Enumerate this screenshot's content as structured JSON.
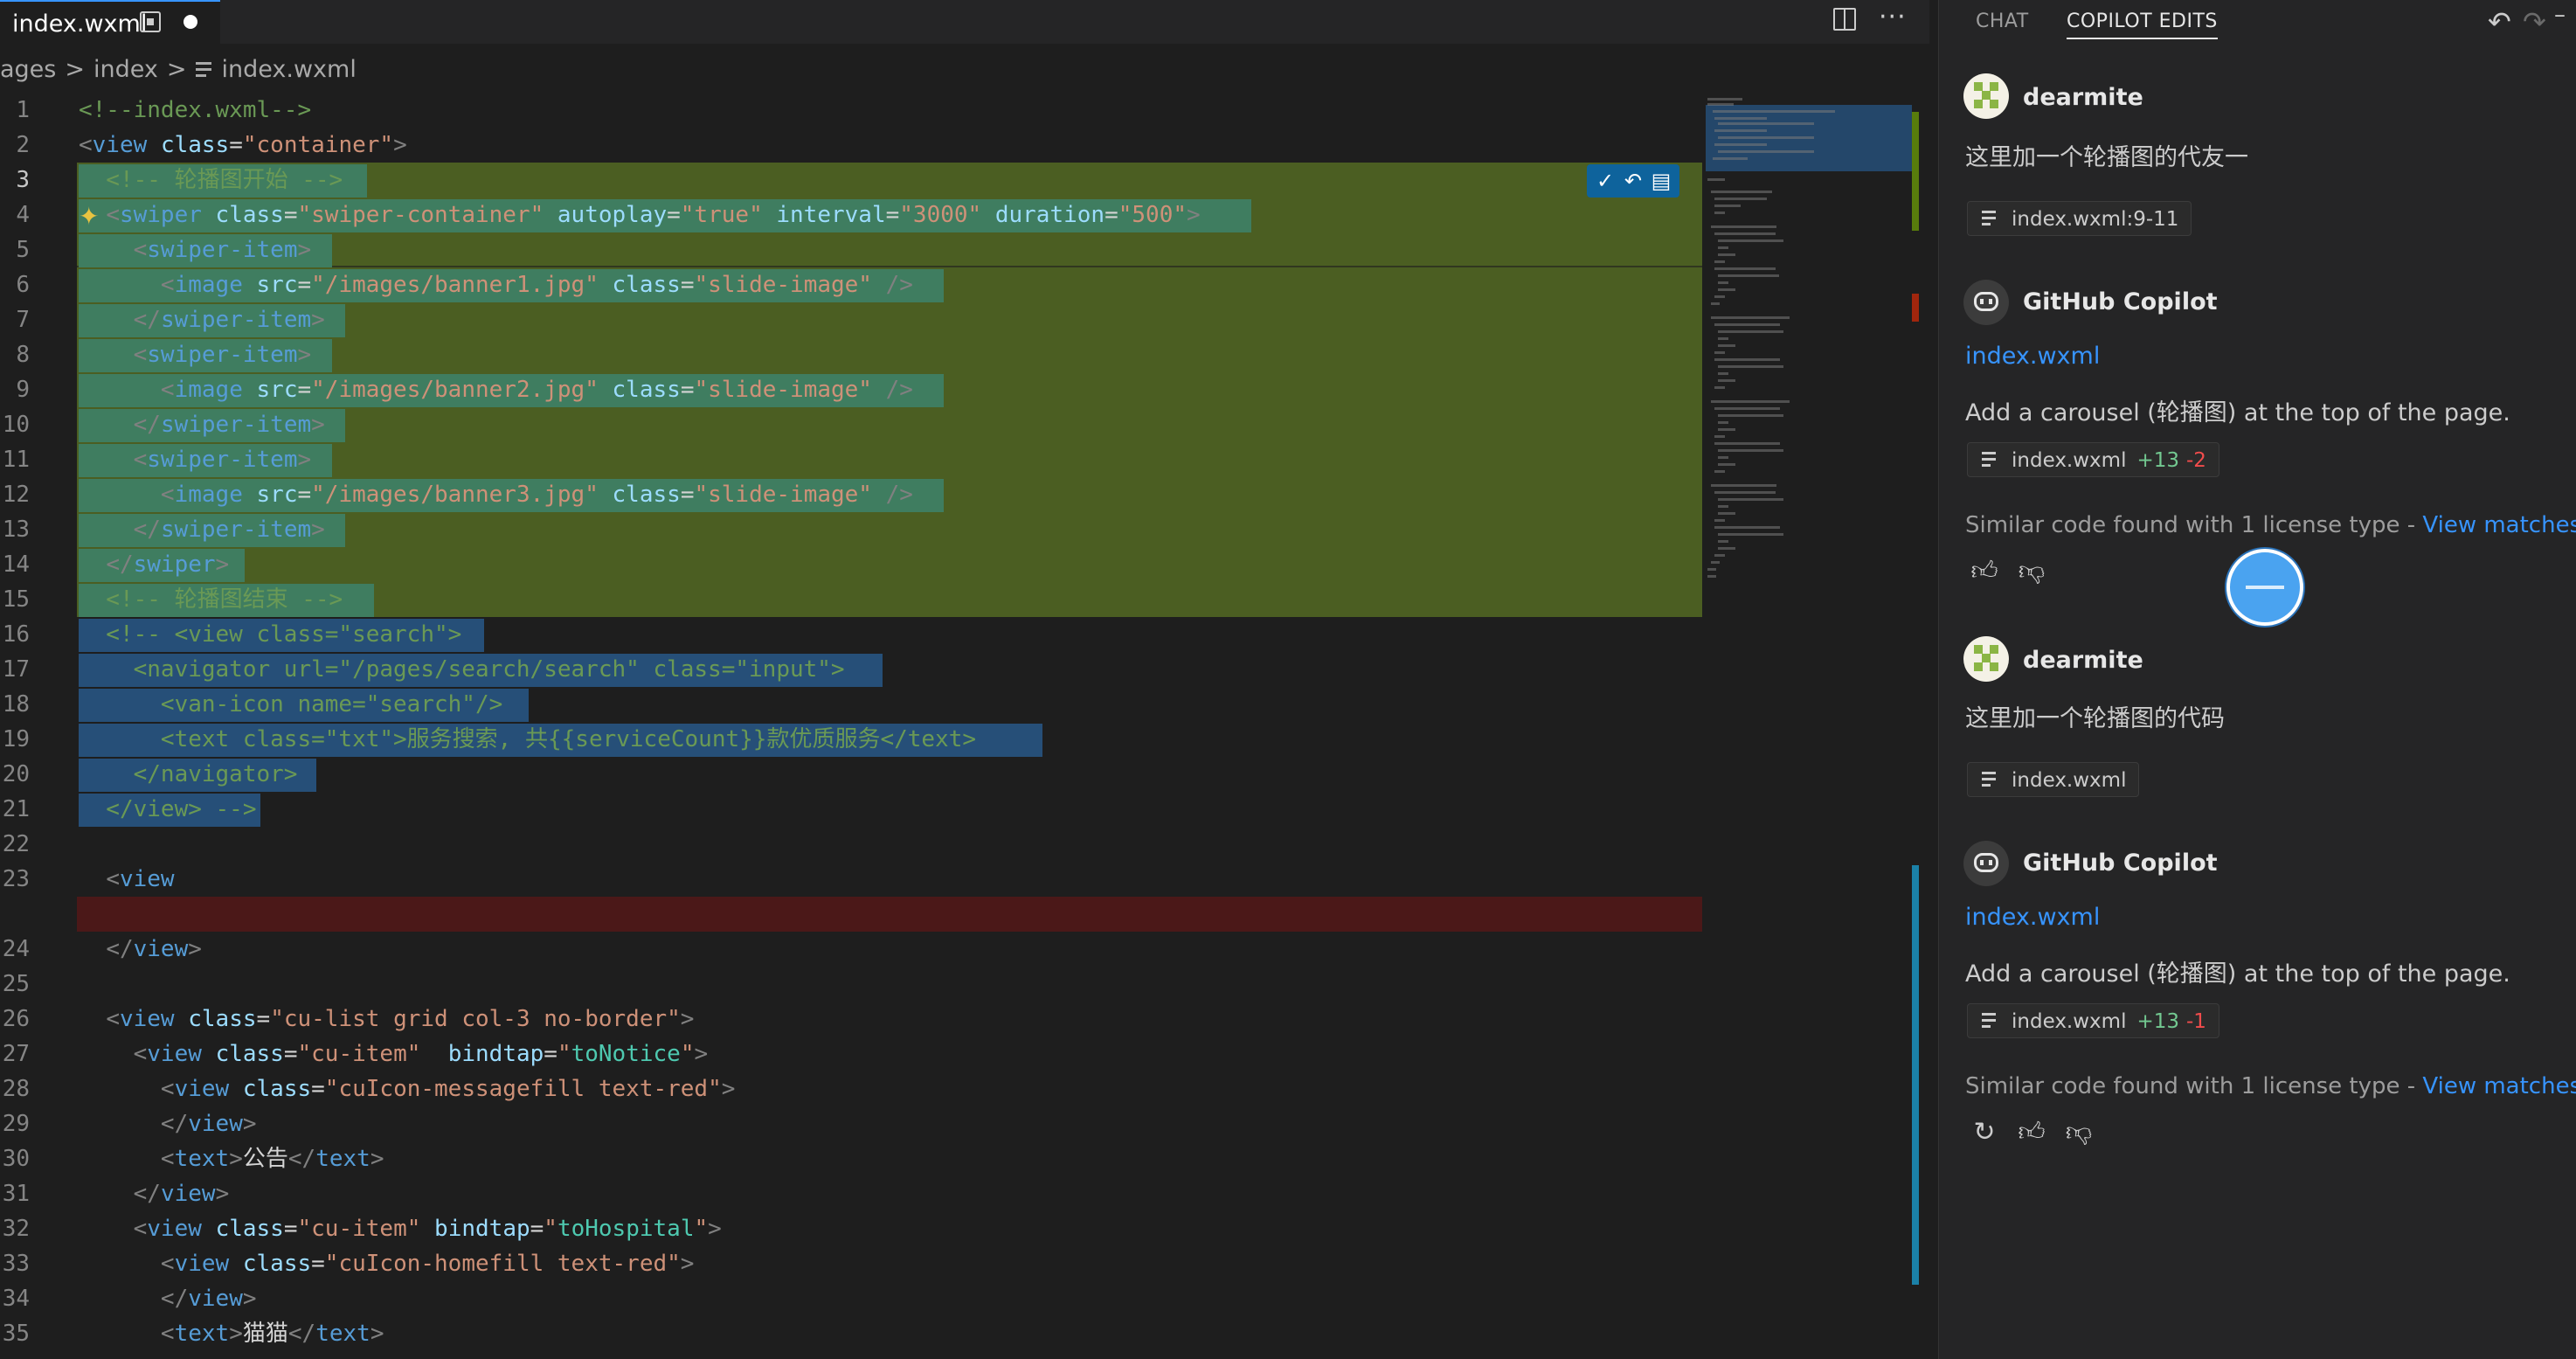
{
  "tab": {
    "label": "index.wxml"
  },
  "breadcrumb": {
    "part1": "ages",
    "part2": "index",
    "file": "index.wxml"
  },
  "code": {
    "l1": {
      "n": "1"
    },
    "l2": {
      "n": "2"
    },
    "l3": {
      "n": "3"
    },
    "l4": {
      "n": "4"
    },
    "l5": {
      "n": "5"
    },
    "l6": {
      "n": "6"
    },
    "l7": {
      "n": "7"
    },
    "l8": {
      "n": "8"
    },
    "l9": {
      "n": "9"
    },
    "l10": {
      "n": "10"
    },
    "l11": {
      "n": "11"
    },
    "l12": {
      "n": "12"
    },
    "l13": {
      "n": "13"
    },
    "l14": {
      "n": "14"
    },
    "l15": {
      "n": "15"
    },
    "l16": {
      "n": "16"
    },
    "l17": {
      "n": "17"
    },
    "l18": {
      "n": "18"
    },
    "l19": {
      "n": "19"
    },
    "l20": {
      "n": "20"
    },
    "l21": {
      "n": "21"
    },
    "l22": {
      "n": "22"
    },
    "l23": {
      "n": "23"
    },
    "l24": {
      "n": "24"
    },
    "l25": {
      "n": "25"
    },
    "l26": {
      "n": "26"
    },
    "l27": {
      "n": "27"
    },
    "l28": {
      "n": "28"
    },
    "l29": {
      "n": "29"
    },
    "l30": {
      "n": "30"
    },
    "l31": {
      "n": "31"
    },
    "l32": {
      "n": "32"
    },
    "l33": {
      "n": "33"
    },
    "l34": {
      "n": "34"
    },
    "l35": {
      "n": "35"
    }
  },
  "panel": {
    "tab_chat": "CHAT",
    "tab_edits": "COPILOT EDITS",
    "msg1": {
      "author": "dearmite",
      "text": "这里加一个轮播图的代友一",
      "chip": "index.wxml:9-11"
    },
    "msg2": {
      "author": "GitHub Copilot",
      "file_link": "index.wxml",
      "text": "Add a carousel (轮播图) at the top of the page.",
      "chip_file": "index.wxml",
      "chip_add": "+13",
      "chip_del": "-2",
      "similar": "Similar code found with 1 license type - ",
      "similar_link": "View matches"
    },
    "msg3": {
      "author": "dearmite",
      "text": "这里加一个轮播图的代码",
      "chip": "index.wxml"
    },
    "msg4": {
      "author": "GitHub Copilot",
      "file_link": "index.wxml",
      "text": "Add a carousel (轮播图) at the top of the page.",
      "chip_file": "index.wxml",
      "chip_add": "+13",
      "chip_del": "-1",
      "similar": "Similar code found with 1 license type - ",
      "similar_link": "View matches"
    }
  },
  "colors": {
    "accent": "#3794ff",
    "added": "#4b5e22",
    "removed": "#4b1818",
    "selection": "#264f78"
  }
}
